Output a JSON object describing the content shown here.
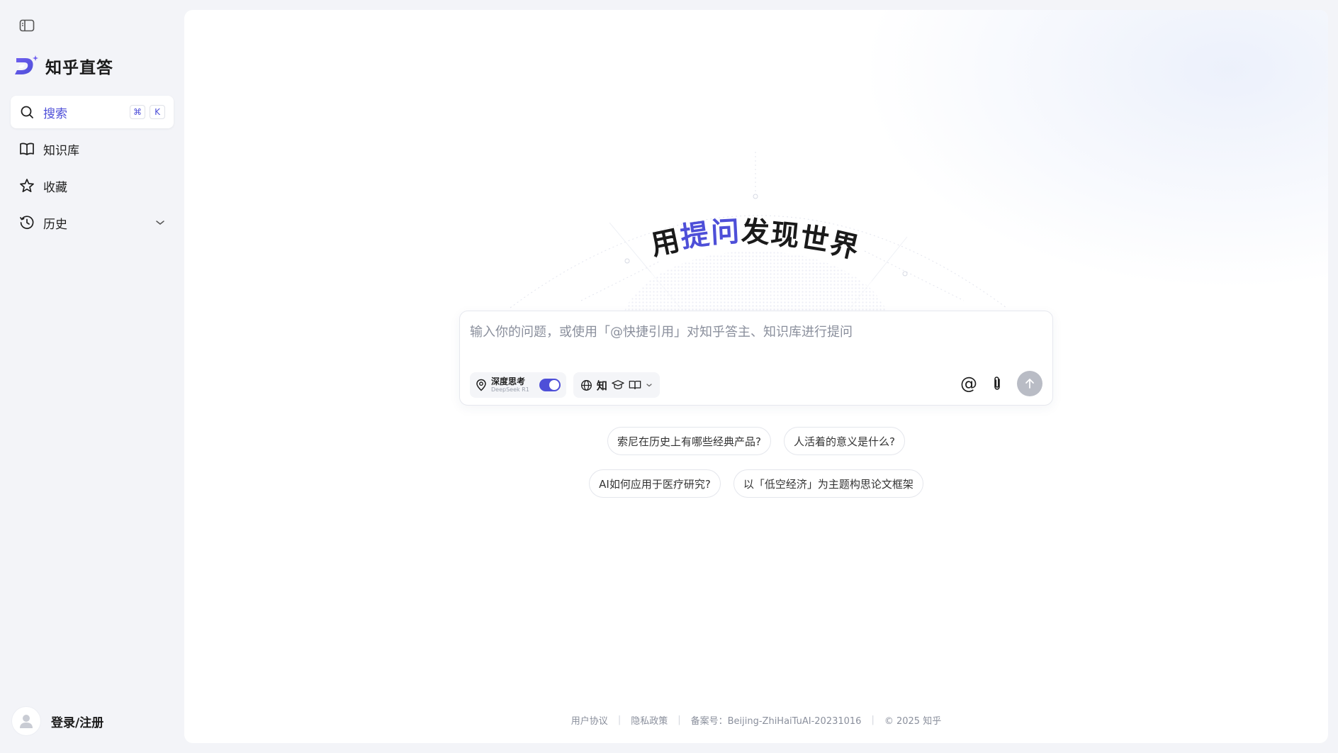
{
  "app": {
    "name": "知乎直答"
  },
  "sidebar": {
    "items": [
      {
        "label": "搜索",
        "shortcut": [
          "⌘",
          "K"
        ]
      },
      {
        "label": "知识库"
      },
      {
        "label": "收藏"
      },
      {
        "label": "历史"
      }
    ],
    "login_label": "登录/注册"
  },
  "hero": {
    "chars": [
      "用",
      "提",
      "问",
      "发",
      "现",
      "世",
      "界"
    ]
  },
  "composer": {
    "placeholder": "输入你的问题，或使用「@快捷引用」对知乎答主、知识库进行提问",
    "deep_think": {
      "label": "深度思考",
      "model": "DeepSeek R1",
      "enabled": true
    },
    "sources": {
      "zhi": "知"
    },
    "at_symbol": "@"
  },
  "suggestions": {
    "row1": [
      "索尼在历史上有哪些经典产品?",
      "人活着的意义是什么?"
    ],
    "row2": [
      "AI如何应用于医疗研究?",
      "以「低空经济」为主题构思论文框架"
    ]
  },
  "footer": {
    "user_agreement": "用户协议",
    "privacy_policy": "隐私政策",
    "icp": "备案号：Beijing-ZhiHaiTuAI-20231016",
    "copyright": "© 2025 知乎"
  },
  "colors": {
    "accent": "#4e4fd8",
    "background": "#f3f4f8",
    "panel": "#ffffff"
  },
  "icons": [
    "sidebar-toggle-icon",
    "logo-icon",
    "search-icon",
    "book-icon",
    "star-icon",
    "clock-icon",
    "chevron-down-icon",
    "user-icon",
    "location-pin-icon",
    "globe-icon",
    "graduation-cap-icon",
    "open-book-icon",
    "paperclip-icon",
    "arrow-up-icon"
  ]
}
